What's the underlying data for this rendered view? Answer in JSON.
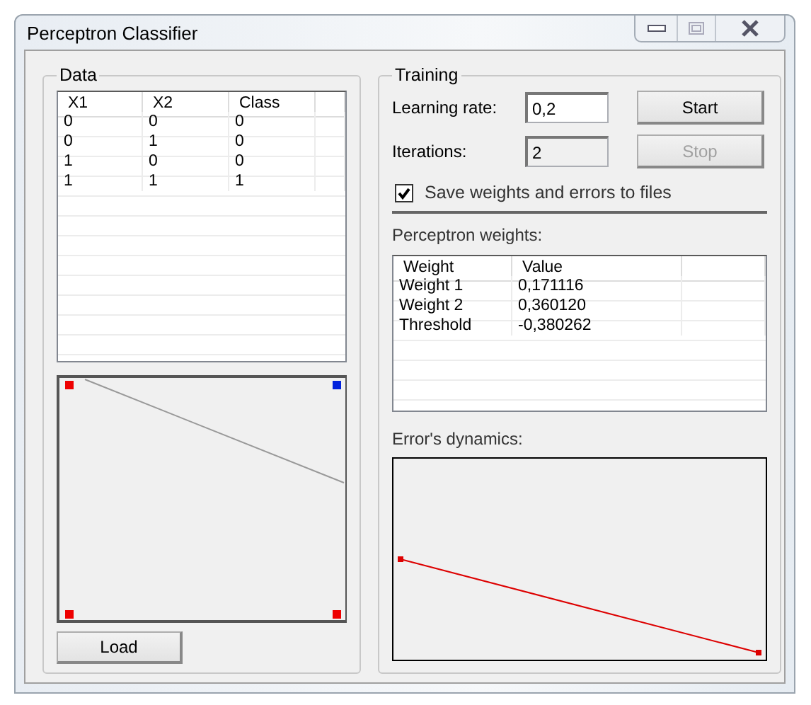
{
  "window": {
    "title": "Perceptron Classifier"
  },
  "data_group": {
    "title": "Data",
    "table": {
      "columns": [
        "X1",
        "X2",
        "Class"
      ],
      "rows": [
        [
          "0",
          "0",
          "0"
        ],
        [
          "0",
          "1",
          "0"
        ],
        [
          "1",
          "0",
          "0"
        ],
        [
          "1",
          "1",
          "1"
        ]
      ]
    },
    "load_button": "Load"
  },
  "training_group": {
    "title": "Training",
    "learning_rate": {
      "label": "Learning rate:",
      "value": "0,2",
      "disabled": false
    },
    "iterations": {
      "label": "Iterations:",
      "value": "2",
      "disabled": true
    },
    "start_button": {
      "label": "Start",
      "disabled": false
    },
    "stop_button": {
      "label": "Stop",
      "disabled": true
    },
    "save_checkbox": {
      "label": "Save weights and errors to files",
      "checked": true
    },
    "weights_label": "Perceptron weights:",
    "weights_table": {
      "columns": [
        "Weight",
        "Value"
      ],
      "rows": [
        [
          "Weight 1",
          "0,171116"
        ],
        [
          "Weight 2",
          "0,360120"
        ],
        [
          "Threshold",
          "-0,380262"
        ]
      ]
    },
    "errors_label": "Error's dynamics:"
  }
}
